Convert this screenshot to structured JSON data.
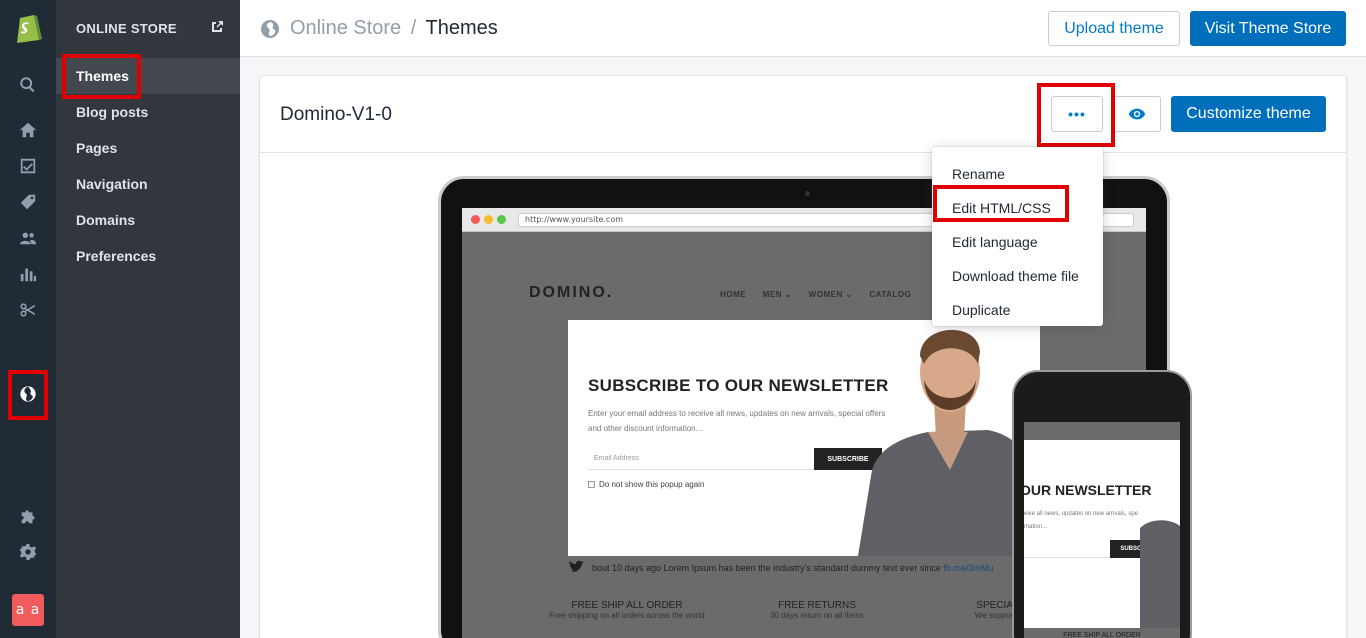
{
  "rail": {
    "avatar_initials": "a a",
    "icons": [
      "shopify-logo-icon",
      "search-icon",
      "home-icon",
      "orders-icon",
      "products-icon",
      "customers-icon",
      "analytics-icon",
      "discounts-icon",
      "online-store-icon",
      "apps-icon",
      "settings-icon"
    ]
  },
  "subnav": {
    "header": "ONLINE STORE",
    "items": [
      {
        "label": "Themes"
      },
      {
        "label": "Blog posts"
      },
      {
        "label": "Pages"
      },
      {
        "label": "Navigation"
      },
      {
        "label": "Domains"
      },
      {
        "label": "Preferences"
      }
    ]
  },
  "topbar": {
    "breadcrumb_parent": "Online Store",
    "breadcrumb_separator": "/",
    "breadcrumb_current": "Themes",
    "upload_label": "Upload theme",
    "visit_store_label": "Visit Theme Store"
  },
  "theme": {
    "name": "Domino-V1-0",
    "more_label": "•••",
    "customize_label": "Customize theme"
  },
  "menu": {
    "items": [
      {
        "label": "Rename"
      },
      {
        "label": "Edit HTML/CSS"
      },
      {
        "label": "Edit language"
      },
      {
        "label": "Download theme file"
      },
      {
        "label": "Duplicate"
      }
    ]
  },
  "preview": {
    "url": "http://www.yoursite.com",
    "site_logo": "DOMINO.",
    "nav": [
      "HOME",
      "MEN ⌄",
      "WOMEN ⌄",
      "CATALOG"
    ],
    "popup_heading": "SUBSCRIBE TO OUR NEWSLETTER",
    "popup_text": "Enter your email address to receive all news, updates on new arrivals, special offers and other discount information...",
    "email_placeholder": "Email Address",
    "subscribe_label": "SUBSCRIBE",
    "checkbox_label": "Do not show this popup again",
    "tweet_text": "bout 10 days ago Lorem Ipsum has been the industry's standard dummy text ever since ",
    "tweet_link": "fb.me/3mMu",
    "footer": [
      {
        "title": "FREE SHIP ALL ORDER",
        "sub": "Free shipping on all orders across the world"
      },
      {
        "title": "FREE RETURNS",
        "sub": "30 days return on all items"
      },
      {
        "title": "SPECIAL GIF",
        "sub": "We support online"
      }
    ],
    "phone_heading": "OUR NEWSLETTER",
    "phone_text": "eive all news, updates on new arrivals, spe mation...",
    "phone_footer": "FREE SHIP ALL ORDER"
  },
  "colors": {
    "rail_bg": "#212b35",
    "subnav_bg": "#31373d",
    "primary": "#006fbb",
    "annotation_red": "#e00000"
  }
}
